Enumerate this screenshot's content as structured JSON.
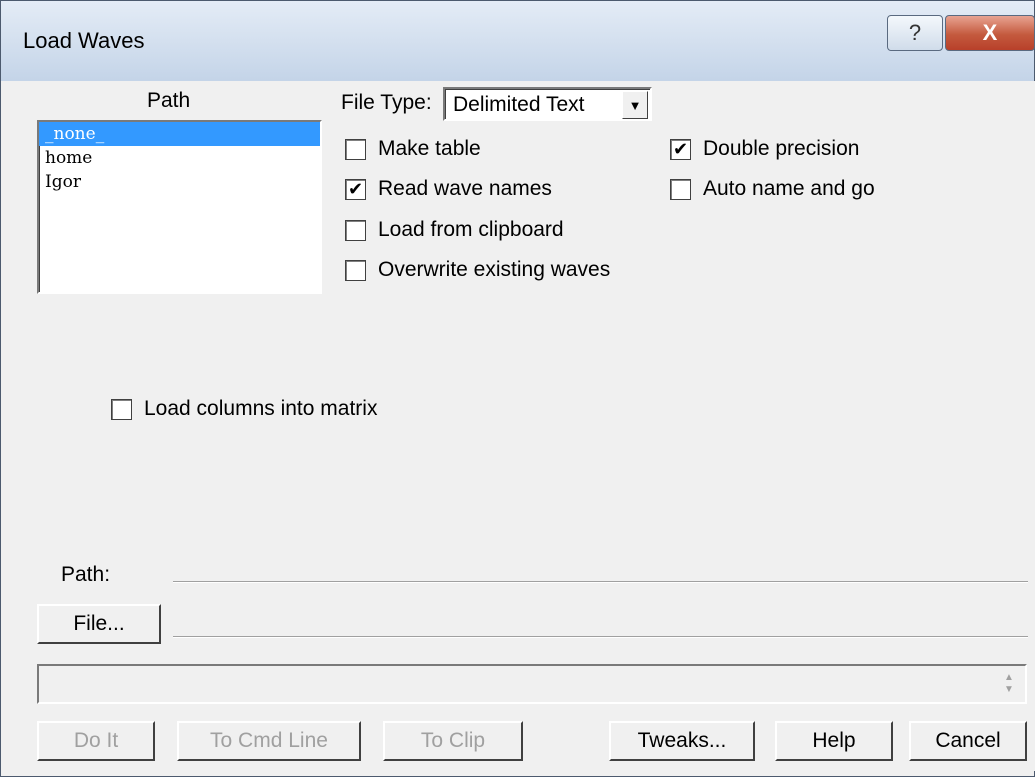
{
  "window": {
    "title": "Load Waves",
    "help_glyph": "?",
    "close_glyph": "X"
  },
  "path_list": {
    "header": "Path",
    "items": [
      "_none_",
      "home",
      "Igor"
    ],
    "selected_index": 0
  },
  "file_type": {
    "label": "File Type:",
    "value": "Delimited Text"
  },
  "options": {
    "make_table": {
      "label": "Make table",
      "checked": false
    },
    "read_wave_names": {
      "label": "Read wave names",
      "checked": true
    },
    "load_from_clipboard": {
      "label": "Load from clipboard",
      "checked": false
    },
    "overwrite_existing_waves": {
      "label": "Overwrite existing waves",
      "checked": false
    },
    "double_precision": {
      "label": "Double precision",
      "checked": true
    },
    "auto_name_and_go": {
      "label": "Auto name and go",
      "checked": false
    },
    "load_columns_into_matrix": {
      "label": "Load columns into matrix",
      "checked": false
    }
  },
  "path_field": {
    "label": "Path:"
  },
  "file_button": {
    "label": "File..."
  },
  "buttons": {
    "do_it": "Do It",
    "to_cmd_line": "To Cmd Line",
    "to_clip": "To Clip",
    "tweaks": "Tweaks...",
    "help": "Help",
    "cancel": "Cancel"
  },
  "check_glyph": "✔",
  "colors": {
    "selection": "#3399ff",
    "dialog_bg": "#f0f0f0",
    "close_button": "#c45a3e"
  }
}
